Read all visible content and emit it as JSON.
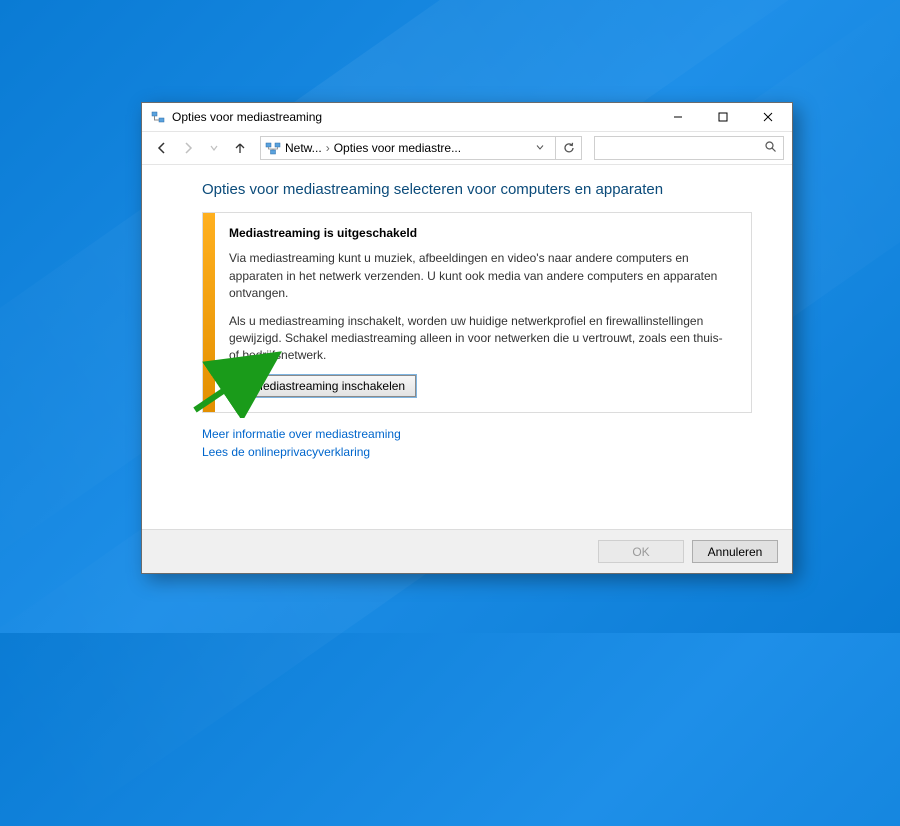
{
  "window": {
    "title": "Opties voor mediastreaming"
  },
  "breadcrumb": {
    "item1": "Netw...",
    "item2": "Opties voor mediastre..."
  },
  "content": {
    "heading": "Opties voor mediastreaming selecteren voor computers en apparaten",
    "subhead": "Mediastreaming is uitgeschakeld",
    "para1": "Via mediastreaming kunt u muziek, afbeeldingen en video's naar andere computers en apparaten in het netwerk verzenden. U kunt ook media van andere computers en apparaten ontvangen.",
    "para2": "Als u mediastreaming inschakelt, worden uw huidige netwerkprofiel en firewallinstellingen gewijzigd. Schakel mediastreaming alleen in voor netwerken die u vertrouwt, zoals een thuis- of bedrijfsnetwerk.",
    "enable_button": "Mediastreaming inschakelen"
  },
  "links": {
    "more_info": "Meer informatie over mediastreaming",
    "privacy": "Lees de onlineprivacyverklaring"
  },
  "footer": {
    "ok": "OK",
    "cancel": "Annuleren"
  }
}
